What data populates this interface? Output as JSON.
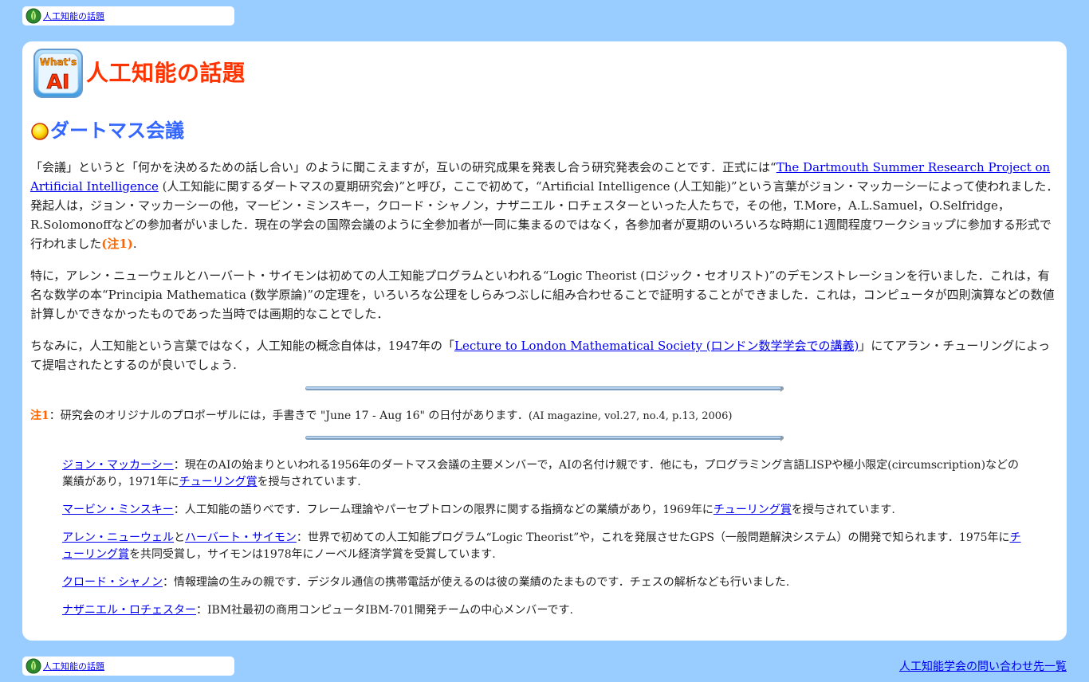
{
  "breadcrumb": {
    "label": "人工知能の話題"
  },
  "header": {
    "logo_text_top": "What's",
    "logo_text_bottom": "AI",
    "title": "人工知能の話題"
  },
  "section": {
    "title": "ダートマス会議"
  },
  "paragraph1": {
    "t1": "「会議」というと「何かを決めるための話し合い」のように聞こえますが，互いの研究成果を発表し合う研究発表会のことです．正式には“",
    "link": "The Dartmouth Summer Research Project on Artificial Intelligence",
    "t2": " (人工知能に関するダートマスの夏期研究会)”と呼び，ここで初めて，“Artificial Intelligence (人工知能)”という言葉がジョン・マッカーシーによって使われました．発起人は，ジョン・マッカーシーの他，マービン・ミンスキー，クロード・シャノン，ナザニエル・ロチェスターといった人たちで，その他，T.More，A.L.Samuel，O.Selfridge，R.Solomonoffなどの参加者がいました．現在の学会の国際会議のように全参加者が一同に集まるのではなく，各参加者が夏期のいろいろな時期に1週間程度ワークショップに参加する形式で行われました",
    "note_ref": "(注1)",
    "t3": "."
  },
  "paragraph2": {
    "text": "特に，アレン・ニューウェルとハーバート・サイモンは初めての人工知能プログラムといわれる“Logic Theorist (ロジック・セオリスト)”のデモンストレーションを行いました．これは，有名な数学の本“Principia Mathematica (数学原論)”の定理を，いろいろな公理をしらみつぶしに組み合わせることで証明することができました．これは，コンピュータが四則演算などの数値計算しかできなかったものであった当時では画期的なことでした．"
  },
  "paragraph3": {
    "t1": "ちなみに，人工知能という言葉ではなく，人工知能の概念自体は，1947年の「",
    "link": "Lecture to London Mathematical Society (ロンドン数学学会での講義)",
    "t2": "」にてアラン・チューリングによって提唱されたとするのが良いでしょう."
  },
  "footnote": {
    "label": "注1",
    "text": "：研究会のオリジナルのプロポーザルには，手書きで \"June 17 - Aug 16\" の日付があります．",
    "citation": "(AI magazine, vol.27, no.4, p.13, 2006)"
  },
  "people": [
    {
      "name": "ジョン・マッカーシー",
      "t1": "：現在のAIの始まりといわれる1956年のダートマス会議の主要メンバーで，AIの名付け親です．他にも，プログラミング言語LISPや極小限定(circumscription)などの業績があり，1971年に",
      "award": "チューリング賞",
      "t2": "を授与されています."
    },
    {
      "name": "マービン・ミンスキー",
      "t1": "：人工知能の語りべです．フレーム理論やパーセプトロンの限界に関する指摘などの業績があり，1969年に",
      "award": "チューリング賞",
      "t2": "を授与されています."
    },
    {
      "name": "アレン・ニューウェル",
      "joiner": "と",
      "name2": "ハーバート・サイモン",
      "t1": "：世界で初めての人工知能プログラム“Logic Theorist”や，これを発展させたGPS（一般問題解決システム）の開発で知られます．1975年に",
      "award": "チューリング賞",
      "t2": "を共同受賞し，サイモンは1978年にノーベル経済学賞を受賞しています."
    },
    {
      "name": "クロード・シャノン",
      "t1": "：情報理論の生みの親です．デジタル通信の携帯電話が使えるのは彼の業績のたまものです．チェスの解析なども行いました."
    },
    {
      "name": "ナザニエル・ロチェスター",
      "t1": "：IBM社最初の商用コンピュータIBM-701開発チームの中心メンバーです."
    }
  ],
  "footer": {
    "contact_link": "人工知能学会の問い合わせ先一覧"
  },
  "colors": {
    "page_bg": "#99ccff",
    "title": "#ff3300",
    "section_title": "#3366ff",
    "note": "#ff6600",
    "link": "#0000ee"
  },
  "icons": {
    "breadcrumb": "green-leaf-icon",
    "logo": "whats-ai-logo",
    "section_bullet": "yellow-ball-icon",
    "divider": "blue-bar-divider"
  }
}
